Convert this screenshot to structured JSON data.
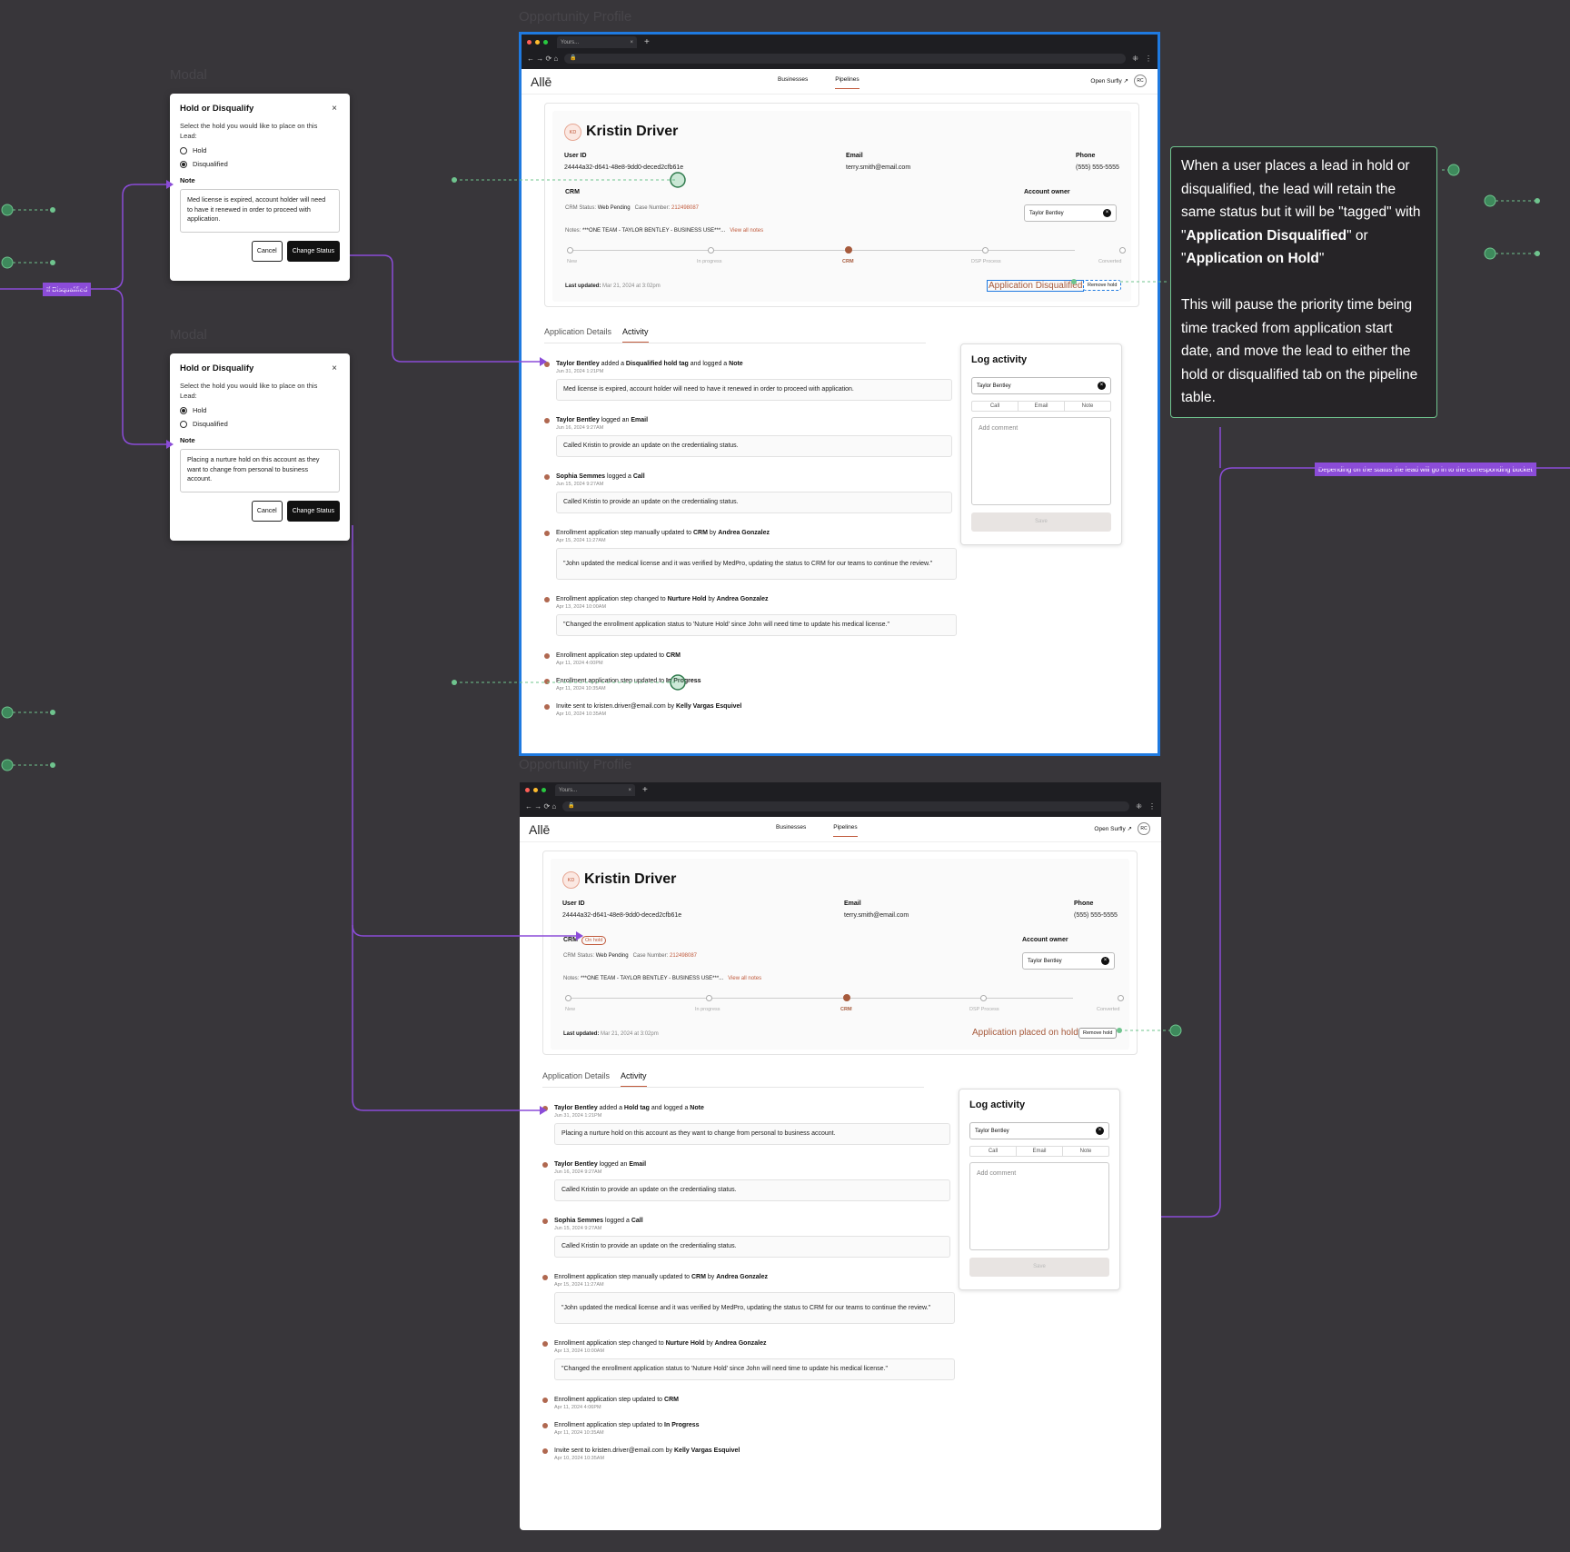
{
  "frame_labels": {
    "modal": "Modal",
    "profile": "Opportunity Profile"
  },
  "flow_labels": {
    "if_disqualified": "If Disqualified",
    "bucket": "Depending on the status the lead will go in to the corresponding bucket"
  },
  "modal_common": {
    "title": "Hold or Disqualify",
    "close": "×",
    "description": "Select the hold you would like to place on this Lead:",
    "option_hold": "Hold",
    "option_disqualified": "Disqualified",
    "note_label": "Note",
    "cancel": "Cancel",
    "change_status": "Change Status"
  },
  "modal_disq": {
    "note": "Med license is expired, account holder will need to have it renewed in order to proceed with application."
  },
  "modal_hold": {
    "note": "Placing a nurture hold on this account as they want to change from personal to business account."
  },
  "browser": {
    "tab_title": "Yours...",
    "plus": "+",
    "nav_icons": "← → ⟳ ⌂",
    "lock": "🔒",
    "menu": "⋮"
  },
  "app": {
    "logo": "Allē",
    "nav_businesses": "Businesses",
    "nav_pipelines": "Pipelines",
    "open_surfly": "Open Surfly ↗",
    "user_initials": "RC"
  },
  "profile": {
    "initials": "KD",
    "name": "Kristin Driver",
    "user_id_label": "User ID",
    "user_id": "24444a32-d641-48e8-9dd0-deced2cfb61e",
    "email_label": "Email",
    "email": "terry.smith@email.com",
    "phone_label": "Phone",
    "phone": "(555) 555-5555",
    "crm_label": "CRM",
    "on_hold_tag": "On hold",
    "crm_status_label": "CRM Status:",
    "crm_status": "Web Pending",
    "case_label": "Case Number:",
    "case_number": "212498087",
    "notes_label": "Notes:",
    "notes": "***ONE TEAM - TAYLOR BENTLEY - BUSINESS USE***...",
    "view_notes": "View all notes",
    "owner_label": "Account owner",
    "owner": "Taylor Bentley",
    "steps": [
      "New",
      "In progress",
      "CRM",
      "DSP Process",
      "Converted"
    ],
    "current_step": 2,
    "last_updated_label": "Last updated:",
    "last_updated": "Mar 21, 2024 at 3:02pm",
    "status_disq": "Application Disqualified",
    "status_hold": "Application placed on hold",
    "remove_hold": "Remove hold"
  },
  "tabs": {
    "details": "Application Details",
    "activity": "Activity"
  },
  "log": {
    "title": "Log activity",
    "user": "Taylor Bentley",
    "tab_call": "Call",
    "tab_email": "Email",
    "tab_note": "Note",
    "placeholder": "Add comment",
    "save": "Save"
  },
  "activity_disq": [
    {
      "html": "<b>Taylor Bentley</b> added a <b>Disqualified hold tag</b> and logged a <b>Note</b>",
      "date": "Jun 31, 2024 1:21PM",
      "box": "Med license is expired, account holder will need to have it renewed in order to proceed with application."
    },
    {
      "html": "<b>Taylor Bentley</b> logged an <b>Email</b>",
      "date": "Jun 16, 2024 9:27AM",
      "box": "Called Kristin to provide an update on the credentialing status."
    },
    {
      "html": "<b>Sophia Semmes</b> logged a <b>Call</b>",
      "date": "Jun 15, 2024 9:27AM",
      "box": "Called Kristin to provide an update on the credentialing status."
    },
    {
      "html": "Enrollment application step manually updated to <b>CRM</b> by <b>Andrea Gonzalez</b>",
      "date": "Apr 15, 2024 11:27AM",
      "box": "\"John updated the medical license and it was verified by MedPro, updating the status to CRM for our teams to continue the review.\""
    },
    {
      "html": "Enrollment application step changed to <b>Nurture Hold</b> by <b>Andrea Gonzalez</b>",
      "date": "Apr 13, 2024 10:00AM",
      "box": "\"Changed the enrollment application status to 'Nuture Hold' since John will need time to update his medical license.\""
    },
    {
      "html": "Enrollment application step updated to <b>CRM</b>",
      "date": "Apr 11, 2024 4:00PM"
    },
    {
      "html": "Enrollment application step updated to <b>In Progress</b>",
      "date": "Apr 11, 2024 10:35AM"
    },
    {
      "html": "Invite sent to kristen.driver@email.com by <b>Kelly Vargas Esquivel</b>",
      "date": "Apr 10, 2024 10:35AM"
    }
  ],
  "activity_hold": [
    {
      "html": "<b>Taylor Bentley</b> added a <b>Hold tag</b> and logged a <b>Note</b>",
      "date": "Jun 31, 2024 1:21PM",
      "box": "Placing a nurture hold on this account as they want to change from personal to business account."
    },
    {
      "html": "<b>Taylor Bentley</b> logged an <b>Email</b>",
      "date": "Jun 16, 2024 9:27AM",
      "box": "Called Kristin to provide an update on the credentialing status."
    },
    {
      "html": "<b>Sophia Semmes</b> logged a <b>Call</b>",
      "date": "Jun 15, 2024 9:27AM",
      "box": "Called Kristin to provide an update on the credentialing status."
    },
    {
      "html": "Enrollment application step manually updated to <b>CRM</b> by <b>Andrea Gonzalez</b>",
      "date": "Apr 15, 2024 11:27AM",
      "box": "\"John updated the medical license and it was verified by MedPro, updating the status to CRM for our teams to continue the review.\""
    },
    {
      "html": "Enrollment application step changed to <b>Nurture Hold</b> by <b>Andrea Gonzalez</b>",
      "date": "Apr 13, 2024 10:00AM",
      "box": "\"Changed the enrollment application status to 'Nuture Hold' since John will need time to update his medical license.\""
    },
    {
      "html": "Enrollment application step updated to <b>CRM</b>",
      "date": "Apr 11, 2024 4:06PM"
    },
    {
      "html": "Enrollment application step updated to <b>In Progress</b>",
      "date": "Apr 11, 2024 10:35AM"
    },
    {
      "html": "Invite sent to kristen.driver@email.com by <b>Kelly Vargas Esquivel</b>",
      "date": "Apr 10, 2024 10:35AM"
    }
  ],
  "info": {
    "html": "When a user places a lead in hold or disqualified, the lead will retain the same status but it will be \"tagged\" with \"<b>Application Disqualified</b>\" or \"<b>Application on Hold</b>\"<br><br>This will pause the priority time being time tracked from application start date, and move the lead to either the hold or disqualified tab on the pipeline table."
  },
  "colors": {
    "accent": "#c05a3c",
    "flow": "#8b4cd8",
    "connector": "#6fc48e",
    "selection": "#1f7ae0"
  }
}
